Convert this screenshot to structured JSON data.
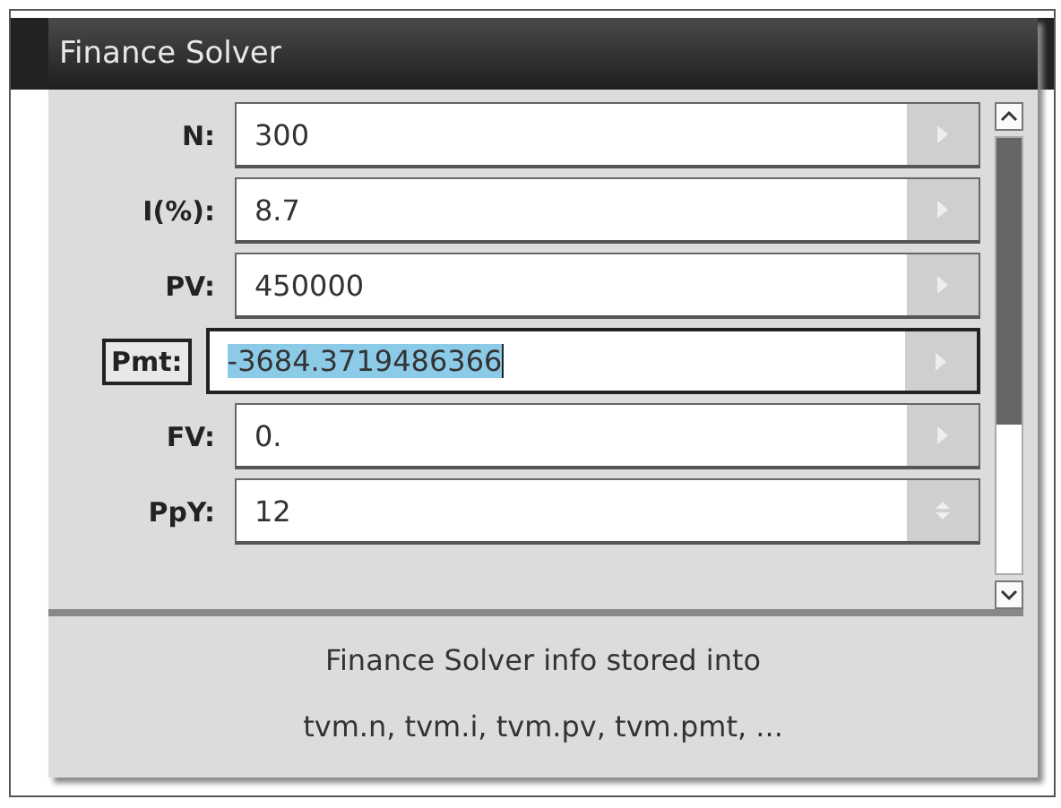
{
  "window": {
    "title": "Finance Solver"
  },
  "fields": [
    {
      "label": "N:",
      "value": "300",
      "selected": false,
      "kind": "arrow"
    },
    {
      "label": "I(%):",
      "value": "8.7",
      "selected": false,
      "kind": "arrow"
    },
    {
      "label": "PV:",
      "value": "450000",
      "selected": false,
      "kind": "arrow"
    },
    {
      "label": "Pmt:",
      "value": "-3684.3719486366",
      "selected": true,
      "kind": "arrow"
    },
    {
      "label": "FV:",
      "value": "0.",
      "selected": false,
      "kind": "arrow"
    },
    {
      "label": "PpY:",
      "value": "12",
      "selected": false,
      "kind": "spinner"
    }
  ],
  "status": [
    "Finance Solver info stored into",
    "tvm.n, tvm.i, tvm.pv, tvm.pmt, ..."
  ]
}
